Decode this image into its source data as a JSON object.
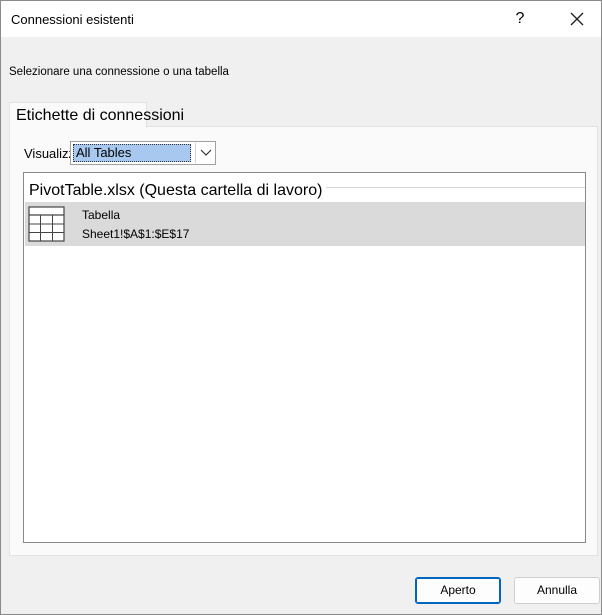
{
  "window": {
    "title": "Connessioni esistenti",
    "help_label": "?"
  },
  "instruction": "Selezionare una connessione o una tabella",
  "tab": {
    "label": "Etichette di connessioni"
  },
  "show": {
    "label": "Visualizza",
    "selected": "All Tables"
  },
  "list": {
    "group_header": "PivotTable.xlsx (Questa cartella di lavoro)",
    "items": [
      {
        "name": "Tabella",
        "detail": "Sheet1!$A$1:$E$17",
        "icon": "table-icon"
      }
    ]
  },
  "buttons": {
    "open_label": "Aperto",
    "cancel_label": "Annulla"
  },
  "colors": {
    "selection_highlight": "#dadada",
    "select_highlight": "#a8c8f0",
    "primary_border": "#0067c0"
  }
}
